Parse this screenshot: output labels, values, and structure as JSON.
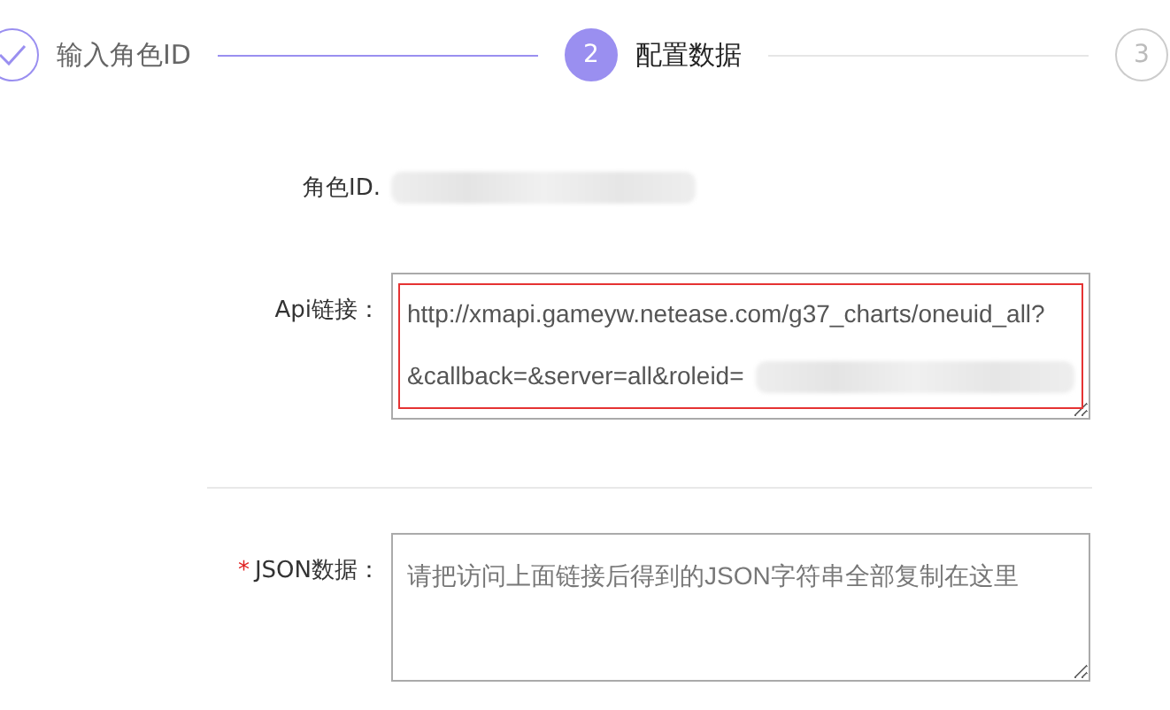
{
  "steps": [
    {
      "label": "输入角色ID",
      "completed": true,
      "selected": false
    },
    {
      "number": "2",
      "label": "配置数据",
      "completed": false,
      "selected": true
    },
    {
      "number": "3",
      "completed": false,
      "selected": false
    }
  ],
  "form": {
    "role_id": {
      "label": "角色ID."
    },
    "api_link": {
      "label": "Api链接：",
      "value": "http://xmapi.gameyw.netease.com/g37_charts/oneuid_all?\n\n&callback=&server=all&roleid=",
      "highlighted": true
    },
    "json_data": {
      "label": "JSON数据：",
      "required": true,
      "required_mark": "*",
      "placeholder": "请把访问上面链接后得到的JSON字符串全部复制在这里"
    }
  }
}
